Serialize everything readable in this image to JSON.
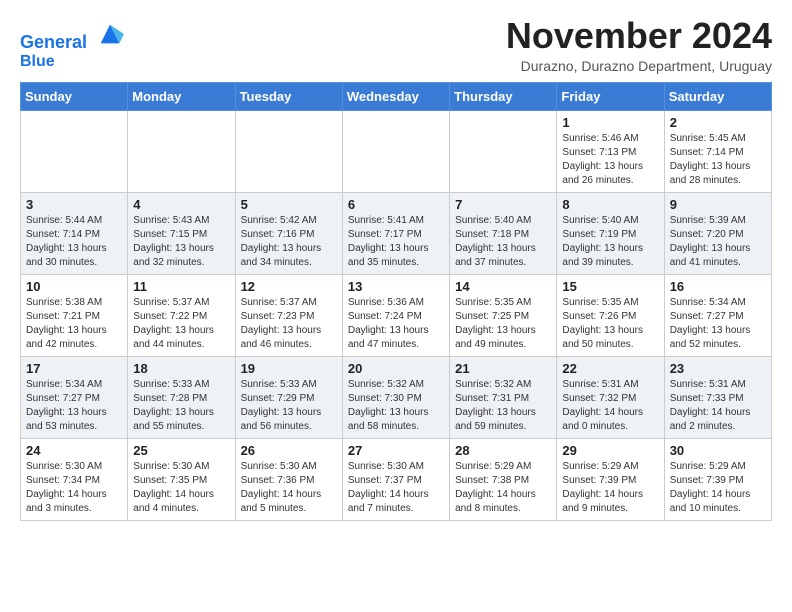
{
  "header": {
    "logo_line1": "General",
    "logo_line2": "Blue",
    "month_title": "November 2024",
    "location": "Durazno, Durazno Department, Uruguay"
  },
  "weekdays": [
    "Sunday",
    "Monday",
    "Tuesday",
    "Wednesday",
    "Thursday",
    "Friday",
    "Saturday"
  ],
  "weeks": [
    [
      {
        "day": "",
        "detail": ""
      },
      {
        "day": "",
        "detail": ""
      },
      {
        "day": "",
        "detail": ""
      },
      {
        "day": "",
        "detail": ""
      },
      {
        "day": "",
        "detail": ""
      },
      {
        "day": "1",
        "detail": "Sunrise: 5:46 AM\nSunset: 7:13 PM\nDaylight: 13 hours and 26 minutes."
      },
      {
        "day": "2",
        "detail": "Sunrise: 5:45 AM\nSunset: 7:14 PM\nDaylight: 13 hours and 28 minutes."
      }
    ],
    [
      {
        "day": "3",
        "detail": "Sunrise: 5:44 AM\nSunset: 7:14 PM\nDaylight: 13 hours and 30 minutes."
      },
      {
        "day": "4",
        "detail": "Sunrise: 5:43 AM\nSunset: 7:15 PM\nDaylight: 13 hours and 32 minutes."
      },
      {
        "day": "5",
        "detail": "Sunrise: 5:42 AM\nSunset: 7:16 PM\nDaylight: 13 hours and 34 minutes."
      },
      {
        "day": "6",
        "detail": "Sunrise: 5:41 AM\nSunset: 7:17 PM\nDaylight: 13 hours and 35 minutes."
      },
      {
        "day": "7",
        "detail": "Sunrise: 5:40 AM\nSunset: 7:18 PM\nDaylight: 13 hours and 37 minutes."
      },
      {
        "day": "8",
        "detail": "Sunrise: 5:40 AM\nSunset: 7:19 PM\nDaylight: 13 hours and 39 minutes."
      },
      {
        "day": "9",
        "detail": "Sunrise: 5:39 AM\nSunset: 7:20 PM\nDaylight: 13 hours and 41 minutes."
      }
    ],
    [
      {
        "day": "10",
        "detail": "Sunrise: 5:38 AM\nSunset: 7:21 PM\nDaylight: 13 hours and 42 minutes."
      },
      {
        "day": "11",
        "detail": "Sunrise: 5:37 AM\nSunset: 7:22 PM\nDaylight: 13 hours and 44 minutes."
      },
      {
        "day": "12",
        "detail": "Sunrise: 5:37 AM\nSunset: 7:23 PM\nDaylight: 13 hours and 46 minutes."
      },
      {
        "day": "13",
        "detail": "Sunrise: 5:36 AM\nSunset: 7:24 PM\nDaylight: 13 hours and 47 minutes."
      },
      {
        "day": "14",
        "detail": "Sunrise: 5:35 AM\nSunset: 7:25 PM\nDaylight: 13 hours and 49 minutes."
      },
      {
        "day": "15",
        "detail": "Sunrise: 5:35 AM\nSunset: 7:26 PM\nDaylight: 13 hours and 50 minutes."
      },
      {
        "day": "16",
        "detail": "Sunrise: 5:34 AM\nSunset: 7:27 PM\nDaylight: 13 hours and 52 minutes."
      }
    ],
    [
      {
        "day": "17",
        "detail": "Sunrise: 5:34 AM\nSunset: 7:27 PM\nDaylight: 13 hours and 53 minutes."
      },
      {
        "day": "18",
        "detail": "Sunrise: 5:33 AM\nSunset: 7:28 PM\nDaylight: 13 hours and 55 minutes."
      },
      {
        "day": "19",
        "detail": "Sunrise: 5:33 AM\nSunset: 7:29 PM\nDaylight: 13 hours and 56 minutes."
      },
      {
        "day": "20",
        "detail": "Sunrise: 5:32 AM\nSunset: 7:30 PM\nDaylight: 13 hours and 58 minutes."
      },
      {
        "day": "21",
        "detail": "Sunrise: 5:32 AM\nSunset: 7:31 PM\nDaylight: 13 hours and 59 minutes."
      },
      {
        "day": "22",
        "detail": "Sunrise: 5:31 AM\nSunset: 7:32 PM\nDaylight: 14 hours and 0 minutes."
      },
      {
        "day": "23",
        "detail": "Sunrise: 5:31 AM\nSunset: 7:33 PM\nDaylight: 14 hours and 2 minutes."
      }
    ],
    [
      {
        "day": "24",
        "detail": "Sunrise: 5:30 AM\nSunset: 7:34 PM\nDaylight: 14 hours and 3 minutes."
      },
      {
        "day": "25",
        "detail": "Sunrise: 5:30 AM\nSunset: 7:35 PM\nDaylight: 14 hours and 4 minutes."
      },
      {
        "day": "26",
        "detail": "Sunrise: 5:30 AM\nSunset: 7:36 PM\nDaylight: 14 hours and 5 minutes."
      },
      {
        "day": "27",
        "detail": "Sunrise: 5:30 AM\nSunset: 7:37 PM\nDaylight: 14 hours and 7 minutes."
      },
      {
        "day": "28",
        "detail": "Sunrise: 5:29 AM\nSunset: 7:38 PM\nDaylight: 14 hours and 8 minutes."
      },
      {
        "day": "29",
        "detail": "Sunrise: 5:29 AM\nSunset: 7:39 PM\nDaylight: 14 hours and 9 minutes."
      },
      {
        "day": "30",
        "detail": "Sunrise: 5:29 AM\nSunset: 7:39 PM\nDaylight: 14 hours and 10 minutes."
      }
    ]
  ]
}
